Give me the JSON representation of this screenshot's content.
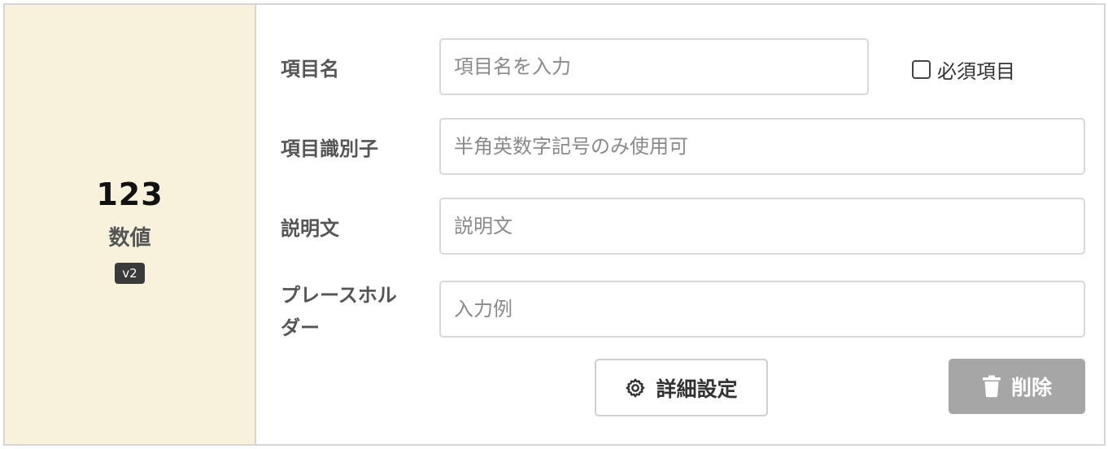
{
  "field_type": {
    "icon_text": "123",
    "label": "数値",
    "badge": "v2"
  },
  "form": {
    "name": {
      "label": "項目名",
      "placeholder": "項目名を入力",
      "value": ""
    },
    "required": {
      "label": "必須項目",
      "checked": false
    },
    "identifier": {
      "label": "項目識別子",
      "placeholder": "半角英数字記号のみ使用可",
      "value": ""
    },
    "description": {
      "label": "説明文",
      "placeholder": "説明文",
      "value": ""
    },
    "placeholder_field": {
      "label_line1": "プレースホル",
      "label_line2": "ダー",
      "placeholder": "入力例",
      "value": ""
    }
  },
  "actions": {
    "settings_label": "詳細設定",
    "settings_icon": "gear-icon",
    "delete_label": "削除",
    "delete_icon": "trash-icon"
  },
  "colors": {
    "type_panel_bg": "#f8f2dd",
    "delete_button_bg": "#a6a6a6",
    "badge_bg": "#3a3a3a"
  }
}
